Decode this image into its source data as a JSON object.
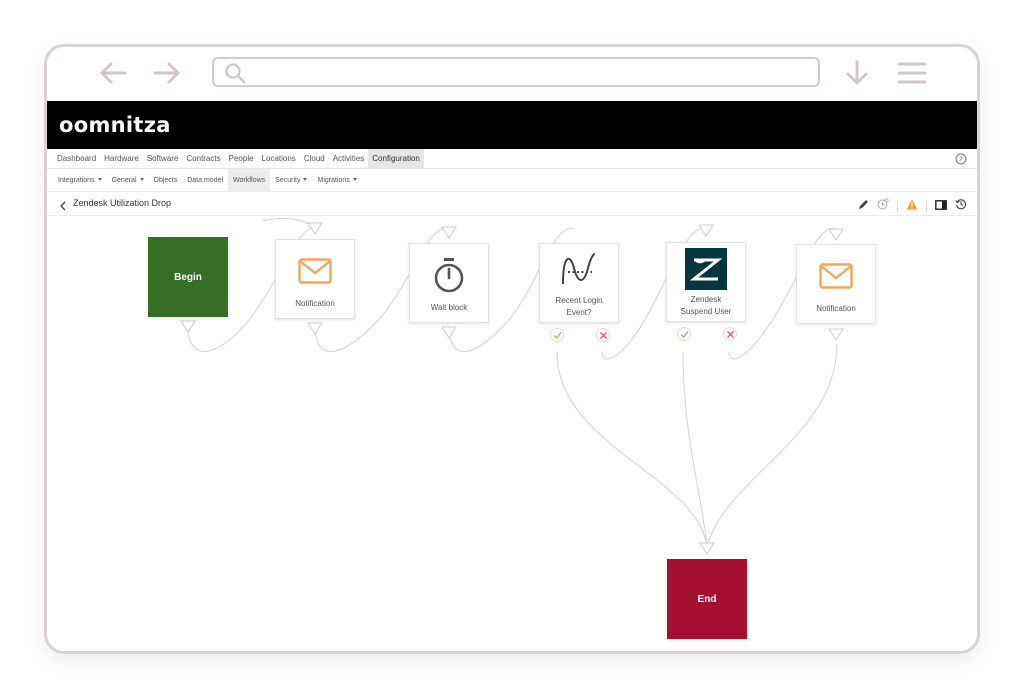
{
  "browser": {
    "url_placeholder": ""
  },
  "app": {
    "logo_text": "oomnitza"
  },
  "main_nav": [
    {
      "label": "Dashboard"
    },
    {
      "label": "Hardware"
    },
    {
      "label": "Software"
    },
    {
      "label": "Contracts"
    },
    {
      "label": "People"
    },
    {
      "label": "Locations"
    },
    {
      "label": "Cloud"
    },
    {
      "label": "Activities"
    },
    {
      "label": "Configuration",
      "active": true
    }
  ],
  "sub_nav": [
    {
      "label": "Integrations",
      "dropdown": true
    },
    {
      "label": "General",
      "dropdown": true
    },
    {
      "label": "Objects"
    },
    {
      "label": "Data model"
    },
    {
      "label": "Workflows",
      "active": true
    },
    {
      "label": "Security",
      "dropdown": true
    },
    {
      "label": "Migrations",
      "dropdown": true
    }
  ],
  "workflow": {
    "title": "Zendesk Utilization Drop"
  },
  "nodes": {
    "begin": {
      "label": "Begin",
      "color": "#366e25"
    },
    "notification1": {
      "label": "Notification",
      "icon": "mail-icon"
    },
    "wait": {
      "label": "Wait block",
      "icon": "stopwatch-icon"
    },
    "recent_login": {
      "label_line1": "Recent Login",
      "label_line2": "Event?",
      "icon": "condition-curve-icon"
    },
    "zendesk": {
      "label_line1": "Zendesk",
      "label_line2": "Suspend User",
      "icon": "zendesk-icon"
    },
    "notification2": {
      "label": "Notification",
      "icon": "mail-icon"
    },
    "end": {
      "label": "End",
      "color": "#a50f32"
    }
  },
  "colors": {
    "accent_orange": "#f2a65a",
    "warning": "#f0a03c",
    "header_bg": "#000000"
  }
}
